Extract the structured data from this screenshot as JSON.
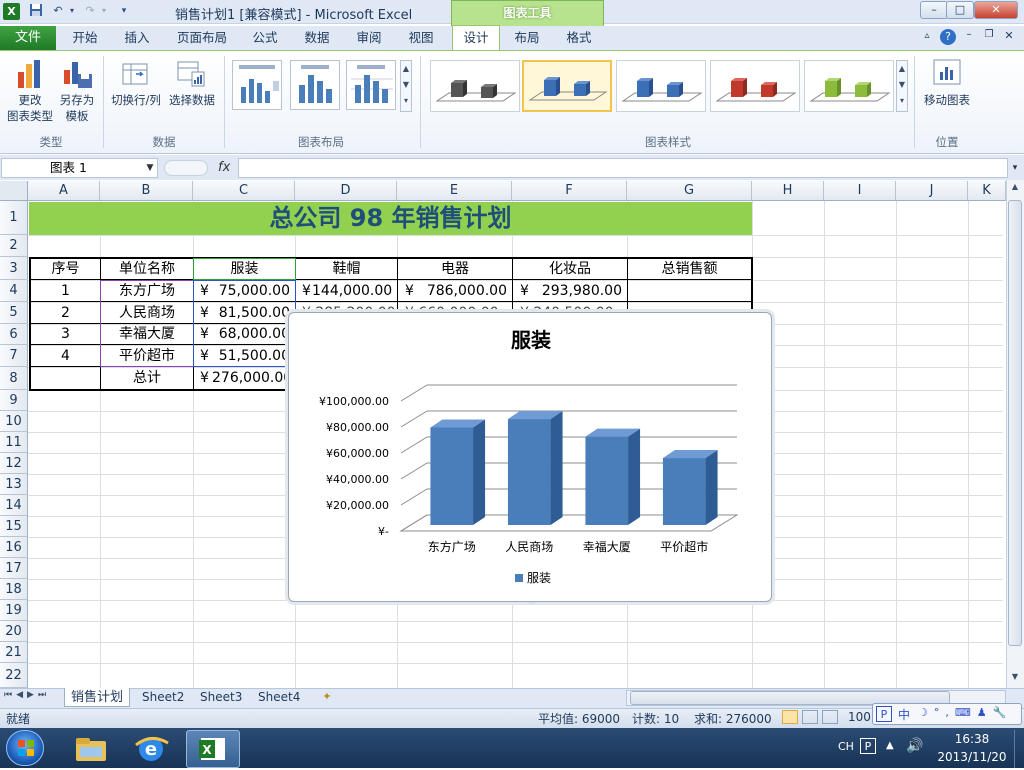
{
  "window": {
    "title": "销售计划1  [兼容模式] - Microsoft Excel",
    "contextual_tab": "图表工具",
    "min_label": "–",
    "max_label": "□",
    "close_label": "✕"
  },
  "ribbon": {
    "file_tab": "文件",
    "tabs": [
      "开始",
      "插入",
      "页面布局",
      "公式",
      "数据",
      "审阅",
      "视图",
      "设计",
      "布局",
      "格式"
    ],
    "active_tab": "设计",
    "groups": {
      "type": {
        "label": "类型",
        "change_type": "更改\n图表类型",
        "change_type_l1": "更改",
        "change_type_l2": "图表类型",
        "save_template_l1": "另存为",
        "save_template_l2": "模板"
      },
      "data": {
        "label": "数据",
        "switch_row_col": "切换行/列",
        "select_data": "选择数据"
      },
      "layouts": {
        "label": "图表布局"
      },
      "styles": {
        "label": "图表样式"
      },
      "location": {
        "label": "位置",
        "move_chart": "移动图表"
      }
    },
    "style_colors": [
      "#555555",
      "#3d6fb6",
      "#3d6fb6",
      "#c0392b",
      "#8dbb3b"
    ]
  },
  "formula_bar": {
    "name_box": "图表 1",
    "fx": "fx",
    "value": ""
  },
  "grid": {
    "columns": [
      "A",
      "B",
      "C",
      "D",
      "E",
      "F",
      "G",
      "H",
      "I",
      "J",
      "K"
    ],
    "rows": [
      "1",
      "2",
      "3",
      "4",
      "5",
      "6",
      "7",
      "8",
      "9",
      "10",
      "11",
      "12",
      "13",
      "14",
      "15",
      "16",
      "17",
      "18",
      "19",
      "20",
      "21",
      "22"
    ],
    "title": "总公司  98  年销售计划",
    "headers": [
      "序号",
      "单位名称",
      "服装",
      "鞋帽",
      "电器",
      "化妆品",
      "总销售额"
    ],
    "data_rows": [
      {
        "no": "1",
        "unit": "东方广场",
        "c": "75,000.00",
        "d": "144,000.00",
        "e": "786,000.00",
        "f": "293,980.00"
      },
      {
        "no": "2",
        "unit": "人民商场",
        "c": "81,500.00"
      },
      {
        "no": "3",
        "unit": "幸福大厦",
        "c": "68,000.00"
      },
      {
        "no": "4",
        "unit": "平价超市",
        "c": "51,500.00"
      }
    ],
    "total_label": "总计",
    "total_c": "276,000.00",
    "currency": "¥",
    "partial_row5_d": "¥  285,200.00",
    "partial_row5_e": "¥    660,000.00",
    "partial_row5_f": "¥   240,500.00"
  },
  "chart_data": {
    "type": "bar",
    "title": "服装",
    "categories": [
      "东方广场",
      "人民商场",
      "幸福大厦",
      "平价超市"
    ],
    "series": [
      {
        "name": "服装",
        "values": [
          75000,
          81500,
          68000,
          51500
        ]
      }
    ],
    "ylim": [
      0,
      100000
    ],
    "yticks": [
      "¥100,000.00",
      "¥80,000.00",
      "¥60,000.00",
      "¥40,000.00",
      "¥20,000.00",
      "¥-"
    ],
    "ytick_values": [
      100000,
      80000,
      60000,
      40000,
      20000,
      0
    ],
    "legend": "bottom",
    "bar_color": "#4a7ebb",
    "grid": true
  },
  "sheets": {
    "tabs": [
      "销售计划",
      "Sheet2",
      "Sheet3",
      "Sheet4"
    ],
    "active": "销售计划"
  },
  "status": {
    "ready": "就绪",
    "average": "平均值: 69000",
    "count": "计数: 10",
    "sum": "求和: 276000",
    "zoom": "100"
  },
  "taskbar": {
    "lang": "CH",
    "time": "16:38",
    "date": "2013/11/20",
    "ime_text": "中"
  }
}
